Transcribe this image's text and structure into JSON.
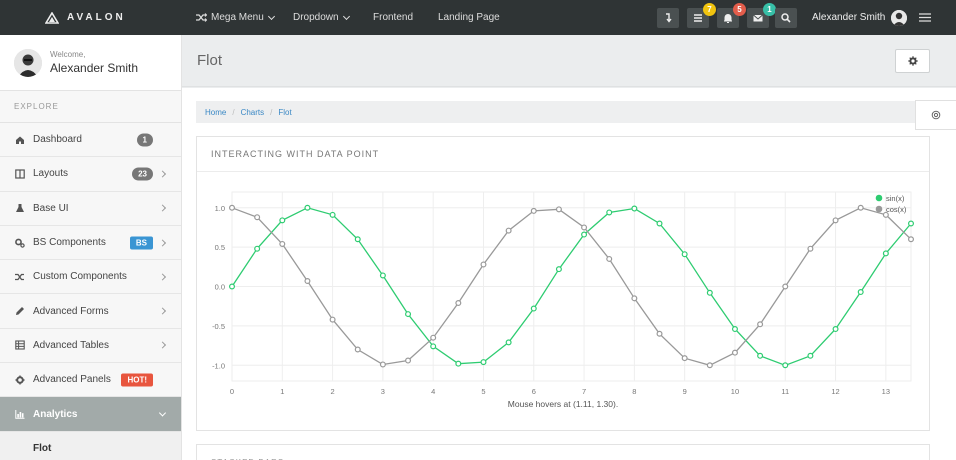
{
  "brand": {
    "name": "AVALON"
  },
  "topnav": [
    {
      "label": "Mega Menu",
      "icon": "shuffle-icon",
      "dropdown": true
    },
    {
      "label": "Dropdown",
      "dropdown": true
    },
    {
      "label": "Frontend"
    },
    {
      "label": "Landing Page"
    }
  ],
  "header_badges": {
    "messages": "7",
    "notifications": "5",
    "mail": "1"
  },
  "colors": {
    "topbar": "#2f3435",
    "accent_green": "#2ecc71",
    "badge_yellow": "#f1c40f",
    "badge_red": "#e35d4b",
    "badge_teal": "#37bfa7",
    "badge_blue": "#3a95d3",
    "badge_hot": "#e8553e",
    "active_item": "#a2aaa9"
  },
  "user": {
    "name": "Alexander Smith",
    "welcome": "Welcome,"
  },
  "sidebar": {
    "section": "EXPLORE",
    "items": [
      {
        "label": "Dashboard",
        "icon": "home-icon",
        "badge": "1"
      },
      {
        "label": "Layouts",
        "icon": "columns-icon",
        "badge": "23"
      },
      {
        "label": "Base UI",
        "icon": "flask-icon"
      },
      {
        "label": "BS Components",
        "icon": "cogs-icon",
        "badge": "BS"
      },
      {
        "label": "Custom Components",
        "icon": "random-icon"
      },
      {
        "label": "Advanced Forms",
        "icon": "pencil-icon"
      },
      {
        "label": "Advanced Tables",
        "icon": "table-icon"
      },
      {
        "label": "Advanced Panels",
        "icon": "gear-icon",
        "badge": "HOT!"
      },
      {
        "label": "Analytics",
        "icon": "bar-chart-icon",
        "active": true
      }
    ],
    "subitem": "Flot"
  },
  "page": {
    "title": "Flot"
  },
  "breadcrumb": [
    "Home",
    "Charts",
    "Flot"
  ],
  "panel": {
    "title": "INTERACTING WITH DATA POINT",
    "hover_text": "Mouse hovers at (1.11, 1.30)."
  },
  "panel2": {
    "title": "STACKED BARS"
  },
  "chart_data": {
    "type": "line",
    "xlim": [
      0,
      13.5
    ],
    "ylim": [
      -1.2,
      1.2
    ],
    "x_ticks": [
      "0",
      "1",
      "2",
      "3",
      "4",
      "5",
      "6",
      "7",
      "8",
      "9",
      "10",
      "11",
      "12",
      "13"
    ],
    "y_ticks": [
      "1.0",
      "0.5",
      "0.0",
      "-0.5",
      "-1.0"
    ],
    "grid": true,
    "legend": "top-right",
    "x": [
      0,
      0.5,
      1,
      1.5,
      2,
      2.5,
      3,
      3.5,
      4,
      4.5,
      5,
      5.5,
      6,
      6.5,
      7,
      7.5,
      8,
      8.5,
      9,
      9.5,
      10,
      10.5,
      11,
      11.5,
      12,
      12.5,
      13,
      13.5
    ],
    "series": [
      {
        "name": "sin(x)",
        "color": "#2ecc71",
        "values": [
          0,
          0.48,
          0.84,
          1.0,
          0.91,
          0.6,
          0.14,
          -0.35,
          -0.76,
          -0.98,
          -0.96,
          -0.71,
          -0.28,
          0.22,
          0.66,
          0.94,
          0.99,
          0.8,
          0.41,
          -0.08,
          -0.54,
          -0.88,
          -1.0,
          -0.88,
          -0.54,
          -0.07,
          0.42,
          0.8
        ]
      },
      {
        "name": "cos(x)",
        "color": "#999999",
        "values": [
          1.0,
          0.88,
          0.54,
          0.07,
          -0.42,
          -0.8,
          -0.99,
          -0.94,
          -0.65,
          -0.21,
          0.28,
          0.71,
          0.96,
          0.98,
          0.75,
          0.35,
          -0.15,
          -0.6,
          -0.91,
          -1.0,
          -0.84,
          -0.48,
          0.0,
          0.48,
          0.84,
          1.0,
          0.91,
          0.6
        ]
      }
    ]
  }
}
